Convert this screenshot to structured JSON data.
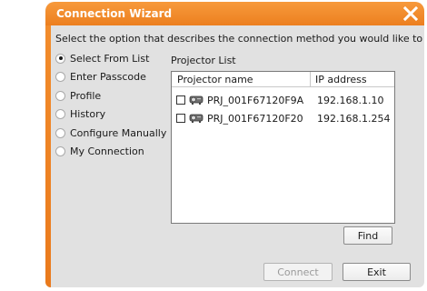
{
  "window": {
    "title": "Connection Wizard",
    "accent_color": "#ee8424"
  },
  "instruction": "Select the option that describes the connection method you would like to use:",
  "options": [
    {
      "label": "Select From List",
      "selected": true
    },
    {
      "label": "Enter Passcode",
      "selected": false
    },
    {
      "label": "Profile",
      "selected": false
    },
    {
      "label": "History",
      "selected": false
    },
    {
      "label": "Configure Manually",
      "selected": false
    },
    {
      "label": "My Connection",
      "selected": false
    }
  ],
  "projector_list": {
    "caption": "Projector List",
    "columns": [
      "Projector name",
      "IP address"
    ],
    "rows": [
      {
        "name": "PRJ_001F67120F9A",
        "ip": "192.168.1.10",
        "checked": false,
        "icon": "projector-icon"
      },
      {
        "name": "PRJ_001F67120F20",
        "ip": "192.168.1.254",
        "checked": false,
        "icon": "projector-icon"
      }
    ]
  },
  "buttons": {
    "find": "Find",
    "connect": "Connect",
    "exit": "Exit"
  }
}
